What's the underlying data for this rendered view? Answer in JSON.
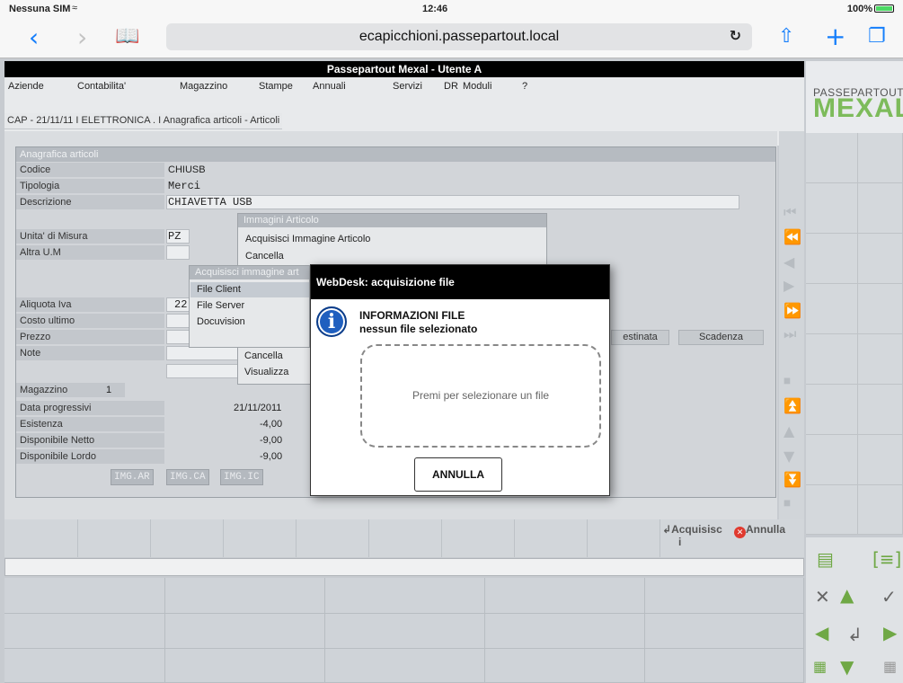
{
  "status": {
    "carrier": "Nessuna SIM",
    "time": "12:46",
    "battery": "100%"
  },
  "browser": {
    "url": "ecapicchioni.passepartout.local"
  },
  "app": {
    "title": "Passepartout Mexal - Utente A"
  },
  "menu": {
    "items": [
      "Aziende",
      "Contabilita'",
      "Magazzino",
      "Stampe",
      "Annuali",
      "Servizi",
      "DR",
      "Moduli",
      "?"
    ]
  },
  "breadcrumb": "CAP - 21/11/11 I ELETTRONICA . I Anagrafica articoli - Articoli",
  "logo": {
    "top": "PASSEPARTOUT",
    "bottom": "MEXAL",
    "brand_color": "#7dbb5b"
  },
  "form": {
    "header": "Anagrafica articoli",
    "labels": {
      "codice": "Codice",
      "tipologia": "Tipologia",
      "descrizione": "Descrizione",
      "um": "Unita' di Misura",
      "altra_um": "Altra U.M",
      "iva": "Aliquota Iva",
      "costo": "Costo ultimo",
      "prezzo": "Prezzo",
      "note": "Note",
      "magazzino": "Magazzino",
      "data_prog": "Data progressivi",
      "esistenza": "Esistenza",
      "disp_netto": "Disponibile Netto",
      "disp_lordo": "Disponibile Lordo"
    },
    "values": {
      "codice": "CHIUSB",
      "tipologia": "Merci",
      "descrizione": "CHIAVETTA USB",
      "um": "PZ",
      "iva": "22",
      "magazzino": "1",
      "data_prog": "21/11/2011",
      "esistenza": "-4,00",
      "disp_netto": "-9,00",
      "disp_lordo": "-9,00"
    },
    "buttons": {
      "destinata": "estinata",
      "scadenza": "Scadenza"
    },
    "img_buttons": [
      "IMG.AR",
      "IMG.CA",
      "IMG.IC"
    ]
  },
  "popup_immagini": {
    "title": "Immagini Articolo",
    "items": [
      "Acquisisci Immagine Articolo",
      "Cancella",
      "Cancella",
      "Visualizza"
    ]
  },
  "popup_acquisisci": {
    "title": "Acquisisci immagine art",
    "items": [
      "File Client",
      "File Server",
      "Docuvision"
    ]
  },
  "modal": {
    "title": "WebDesk: acquisizione file",
    "info_title": "INFORMAZIONI FILE",
    "info_sub": "nessun file selezionato",
    "dropzone": "Premi per selezionare un file",
    "cancel": "ANNULLA"
  },
  "footer": {
    "acquisisci": "Acquisisc",
    "acquisisci_wrap": "i",
    "annulla": "Annulla"
  }
}
